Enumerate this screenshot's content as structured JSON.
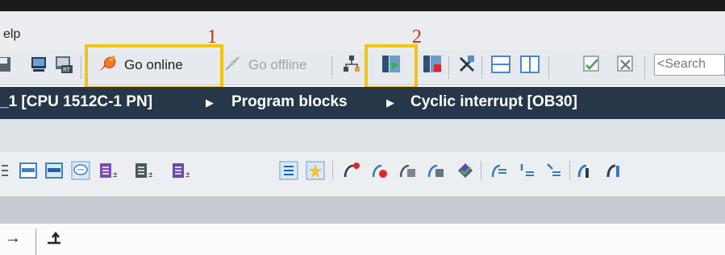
{
  "menu": {
    "help_partial": "elp"
  },
  "toolbar": {
    "go_online_label": "Go online",
    "go_offline_label": "Go offline",
    "search_placeholder": "<Search"
  },
  "annotations": {
    "first": "1",
    "second": "2"
  },
  "breadcrumb": {
    "items": [
      "_1 [CPU 1512C-1 PN]",
      "Program blocks",
      "Cyclic interrupt [OB30]"
    ]
  },
  "colors": {
    "highlight": "#f2c40f",
    "annotation": "#c42a1a",
    "breadcrumb_bg": "#26374a"
  },
  "icons": {
    "toolbar_left": [
      "save-icon",
      "device-icon",
      "compile-rt-icon"
    ],
    "toolbar_right": [
      "accessible-devices-icon",
      "start-simulation-icon",
      "stop-simulation-icon",
      "cross-reference-icon",
      "split-horizontal-icon",
      "split-vertical-icon",
      "compare-icon",
      "compare-all-icon"
    ],
    "editor_toolbar": [
      "list-icon",
      "insert-row-icon",
      "delete-row-icon",
      "comment-icon",
      "absolute-operand-icon",
      "symbol-operand-icon",
      "symbol-absolute-icon",
      "network-icon",
      "favorites-icon",
      "monitor-on-icon",
      "monitor-go-icon",
      "monitor-block-icon",
      "monitor-list-icon",
      "modify-icon",
      "goto-icon",
      "goto-list-icon",
      "goto-next-icon",
      "jump-icon",
      "jump-back-icon"
    ],
    "bottom": [
      "arrow-right-icon",
      "arrow-return-icon"
    ]
  }
}
